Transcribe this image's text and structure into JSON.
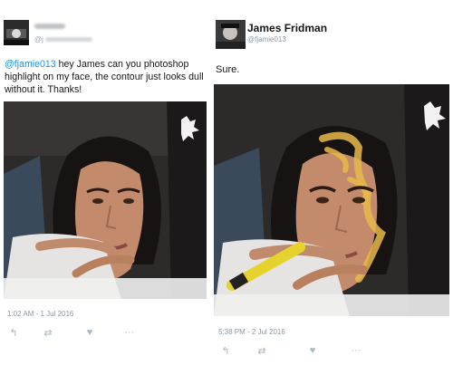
{
  "left_tweet": {
    "user": {
      "name": "",
      "handle_prefix": "@j"
    },
    "mention": "@fjamie013",
    "text": " hey James can you photoshop highlight on my face, the contour just looks dull without it. Thanks!",
    "timestamp": "1:02 AM - 1 Jul 2016",
    "actions": {
      "reply": "reply-icon",
      "retweet": "retweet-icon",
      "like": "like-icon",
      "more": "more-icon"
    }
  },
  "right_tweet": {
    "user": {
      "name": "James Fridman",
      "handle": "@fjamie013"
    },
    "text": "Sure.",
    "timestamp": "5:38 PM - 2 Jul 2016",
    "actions": {
      "reply": "reply-icon",
      "retweet": "retweet-icon",
      "like": "like-icon",
      "more": "more-icon"
    }
  },
  "colors": {
    "link": "#1b95e0",
    "meta": "#8899a6",
    "icon": "#aab8c2",
    "highlight": "#e8b94a"
  }
}
